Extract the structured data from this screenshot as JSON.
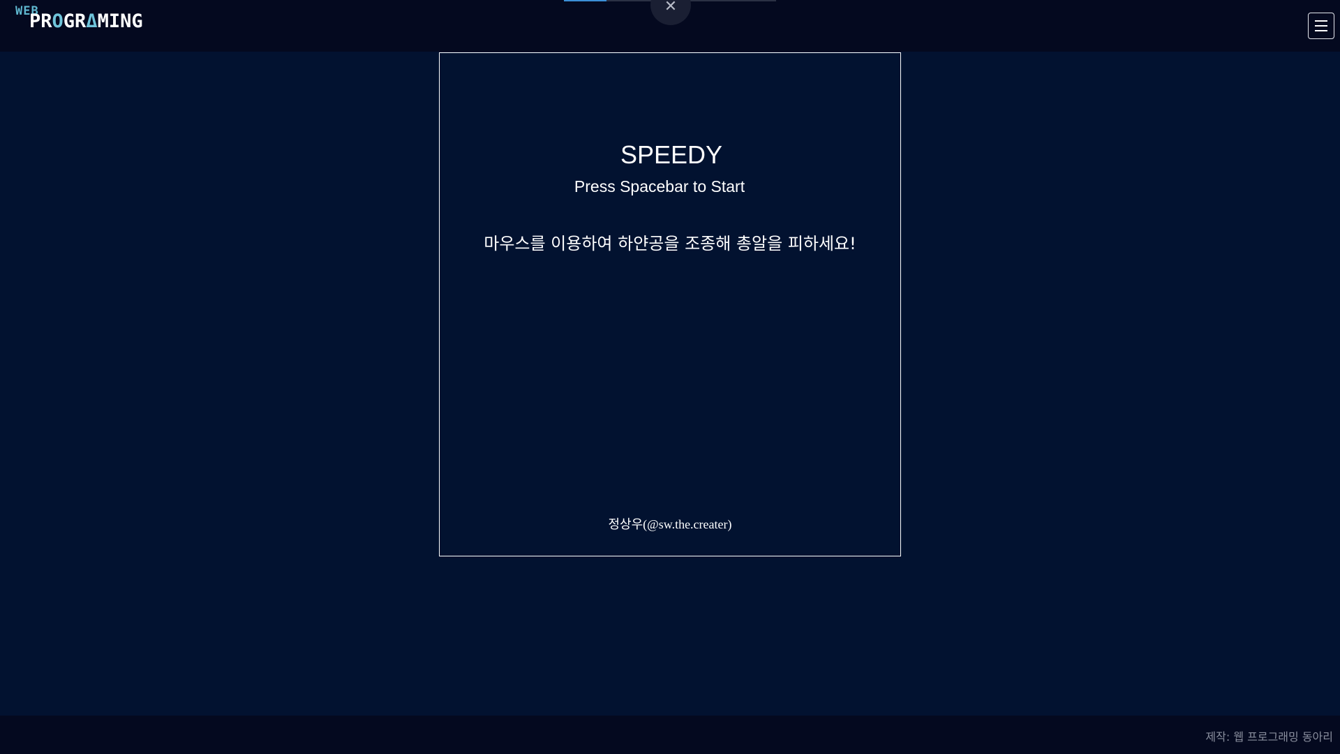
{
  "header": {
    "logo_small": "WEB",
    "logo_main_parts": [
      "PR",
      "O",
      "GR",
      "Δ",
      "MING"
    ],
    "progress_fraction": 0.2,
    "close_symbol": "✕",
    "close_icon": "close-icon",
    "menu_icon": "hamburger-menu-icon"
  },
  "game": {
    "title": "SPEEDY",
    "subtitle": "Press Spacebar to Start",
    "instruction": "마우스를 이용하여 하얀공을 조종해 총알을 피하세요!",
    "credit": "정상우(@sw.the.creater)"
  },
  "footer": {
    "credit": "제작: 웹 프로그래밍 동아리"
  },
  "colors": {
    "background": "#021230",
    "bar": "#04091f",
    "accent": "#6fc4da",
    "progress": "#3b8fd6"
  }
}
